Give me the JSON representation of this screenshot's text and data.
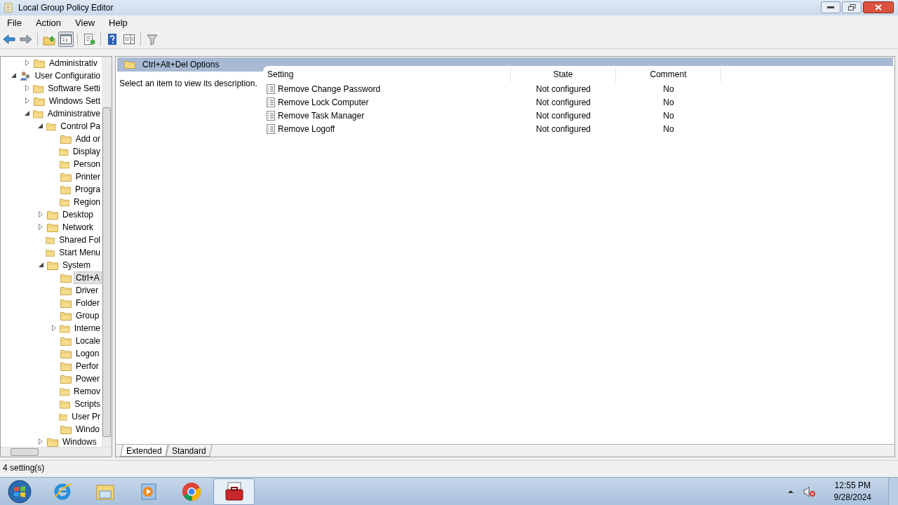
{
  "window": {
    "title": "Local Group Policy Editor"
  },
  "menu": [
    "File",
    "Action",
    "View",
    "Help"
  ],
  "toolbar": [
    {
      "kind": "back",
      "pressed": false
    },
    {
      "kind": "forward",
      "pressed": false
    },
    {
      "kind": "sep"
    },
    {
      "kind": "up",
      "pressed": false
    },
    {
      "kind": "tree",
      "pressed": true
    },
    {
      "kind": "sep"
    },
    {
      "kind": "export",
      "pressed": false
    },
    {
      "kind": "sep"
    },
    {
      "kind": "help",
      "pressed": false
    },
    {
      "kind": "panel",
      "pressed": false
    },
    {
      "kind": "sep"
    },
    {
      "kind": "filter",
      "pressed": false
    }
  ],
  "tree": {
    "above": [
      {
        "label": "Administrativ",
        "expanded": false,
        "selected": false
      }
    ],
    "items": [
      {
        "label": "User Configuratio",
        "kind": "user",
        "expanded": true,
        "selected": false,
        "children": [
          {
            "label": "Software Setti",
            "expanded": false,
            "selected": false
          },
          {
            "label": "Windows Sett",
            "expanded": false,
            "selected": false
          },
          {
            "label": "Administrative",
            "expanded": true,
            "selected": false,
            "children": [
              {
                "label": "Control Pa",
                "expanded": true,
                "selected": false,
                "children": [
                  {
                    "label": "Add or",
                    "selected": false
                  },
                  {
                    "label": "Display",
                    "selected": false
                  },
                  {
                    "label": "Person",
                    "selected": false
                  },
                  {
                    "label": "Printer",
                    "selected": false
                  },
                  {
                    "label": "Progra",
                    "selected": false
                  },
                  {
                    "label": "Region",
                    "selected": false
                  }
                ]
              },
              {
                "label": "Desktop",
                "expanded": false,
                "selected": false
              },
              {
                "label": "Network",
                "expanded": false,
                "selected": false
              },
              {
                "label": "Shared Fol",
                "selected": false
              },
              {
                "label": "Start Menu",
                "selected": false
              },
              {
                "label": "System",
                "expanded": true,
                "selected": false,
                "children": [
                  {
                    "label": "Ctrl+A",
                    "selected": true
                  },
                  {
                    "label": "Driver",
                    "selected": false
                  },
                  {
                    "label": "Folder",
                    "selected": false
                  },
                  {
                    "label": "Group",
                    "selected": false
                  },
                  {
                    "label": "Interne",
                    "expanded": false,
                    "selected": false
                  },
                  {
                    "label": "Locale",
                    "selected": false
                  },
                  {
                    "label": "Logon",
                    "selected": false
                  },
                  {
                    "label": "Perfor",
                    "selected": false
                  },
                  {
                    "label": "Power",
                    "selected": false
                  },
                  {
                    "label": "Remov",
                    "selected": false
                  },
                  {
                    "label": "Scripts",
                    "selected": false
                  },
                  {
                    "label": "User Pr",
                    "selected": false
                  },
                  {
                    "label": "Windo",
                    "selected": false
                  }
                ]
              },
              {
                "label": "Windows",
                "expanded": false,
                "selected": false
              }
            ]
          }
        ]
      }
    ]
  },
  "details": {
    "heading": "Ctrl+Alt+Del Options",
    "description": "Select an item to view its description.",
    "columns": [
      "Setting",
      "State",
      "Comment"
    ],
    "rows": [
      {
        "setting": "Remove Change Password",
        "state": "Not configured",
        "comment": "No"
      },
      {
        "setting": "Remove Lock Computer",
        "state": "Not configured",
        "comment": "No"
      },
      {
        "setting": "Remove Task Manager",
        "state": "Not configured",
        "comment": "No"
      },
      {
        "setting": "Remove Logoff",
        "state": "Not configured",
        "comment": "No"
      }
    ],
    "tabs": [
      {
        "label": "Extended",
        "selected": true
      },
      {
        "label": "Standard",
        "selected": false
      }
    ]
  },
  "status_bar": "4 setting(s)",
  "taskbar": {
    "items": [
      {
        "kind": "ie",
        "selected": false
      },
      {
        "kind": "explorer",
        "selected": false
      },
      {
        "kind": "media",
        "selected": false
      },
      {
        "kind": "chrome",
        "selected": false
      },
      {
        "kind": "toolbox",
        "selected": true
      }
    ],
    "time": "12:55 PM",
    "date": "9/28/2024",
    "muted": true
  }
}
